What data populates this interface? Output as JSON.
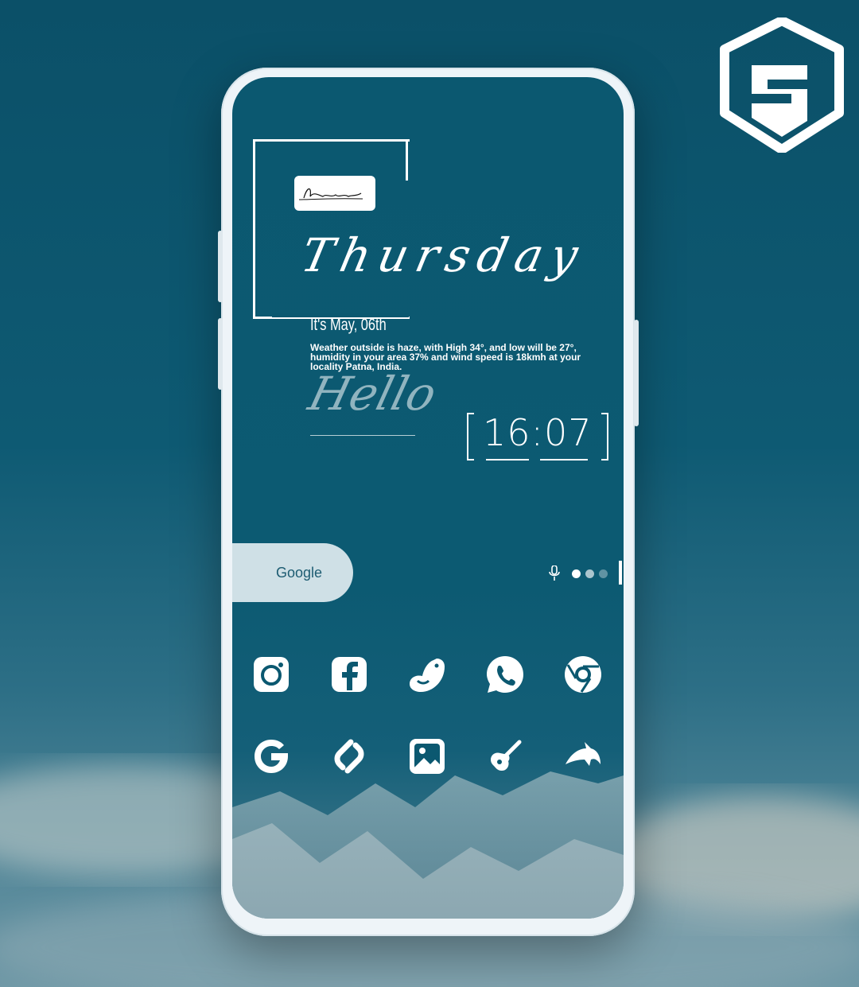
{
  "brand": {
    "logo_name": "ss-triangle-logo"
  },
  "widget": {
    "signature": "Ashish",
    "day": "Thursday",
    "date": "It's May, 06th",
    "weather": "Weather outside is haze, with High 34°, and low will be 27°, humidity in your area 37% and wind speed is 18kmh at your locality Patna, India.",
    "greeting": "Hello",
    "time": "16:07"
  },
  "search": {
    "label": "Google"
  },
  "pager": {
    "pages": 3,
    "active": 0
  },
  "dock": {
    "row1": [
      "instagram-icon",
      "facebook-icon",
      "twitter-bird-icon",
      "whatsapp-icon",
      "chrome-icon"
    ],
    "row2": [
      "google-icon",
      "shazam-icon",
      "gallery-icon",
      "music-guitar-icon",
      "dolphin-icon"
    ]
  },
  "colors": {
    "background": "#0b5870",
    "accent": "#ffffff",
    "pill": "#cfe0e6"
  }
}
